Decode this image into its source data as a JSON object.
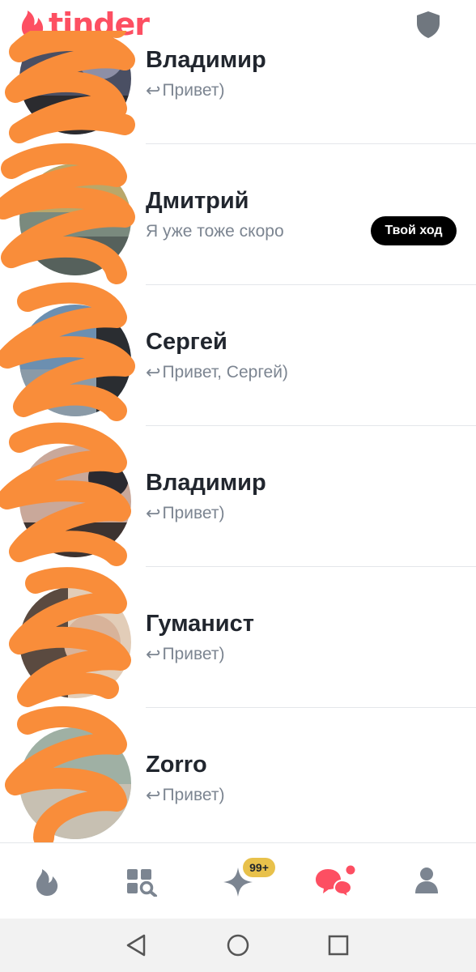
{
  "app": {
    "logo_text": "tinder"
  },
  "header": {
    "shield_icon": "shield-icon"
  },
  "conversations": [
    {
      "name": "Владимир",
      "message": "Привет)",
      "replied": true,
      "badge": ""
    },
    {
      "name": "Дмитрий",
      "message": "Я уже тоже скоро",
      "replied": false,
      "badge": "Твой ход"
    },
    {
      "name": "Сергей",
      "message": "Привет, Сергей)",
      "replied": true,
      "badge": ""
    },
    {
      "name": "Владимир",
      "message": "Привет)",
      "replied": true,
      "badge": ""
    },
    {
      "name": "Гуманист",
      "message": "Привет)",
      "replied": true,
      "badge": ""
    },
    {
      "name": "Zorro",
      "message": "Привет)",
      "replied": true,
      "badge": ""
    }
  ],
  "tabbar": {
    "tabs": [
      {
        "id": "swipe",
        "icon": "flame-icon",
        "active": false
      },
      {
        "id": "explore",
        "icon": "explore-grid-icon",
        "active": false
      },
      {
        "id": "gold",
        "icon": "sparkle-icon",
        "active": false,
        "badge": "99+"
      },
      {
        "id": "messages",
        "icon": "chat-bubbles-icon",
        "active": true
      },
      {
        "id": "profile",
        "icon": "person-icon",
        "active": false
      }
    ]
  },
  "system_nav": [
    "back-icon",
    "home-icon",
    "recents-icon"
  ],
  "colors": {
    "brand": "#fd4f62",
    "scribble": "#f98d3a",
    "badge_bg": "#000000",
    "gold": "#e8c14b"
  }
}
